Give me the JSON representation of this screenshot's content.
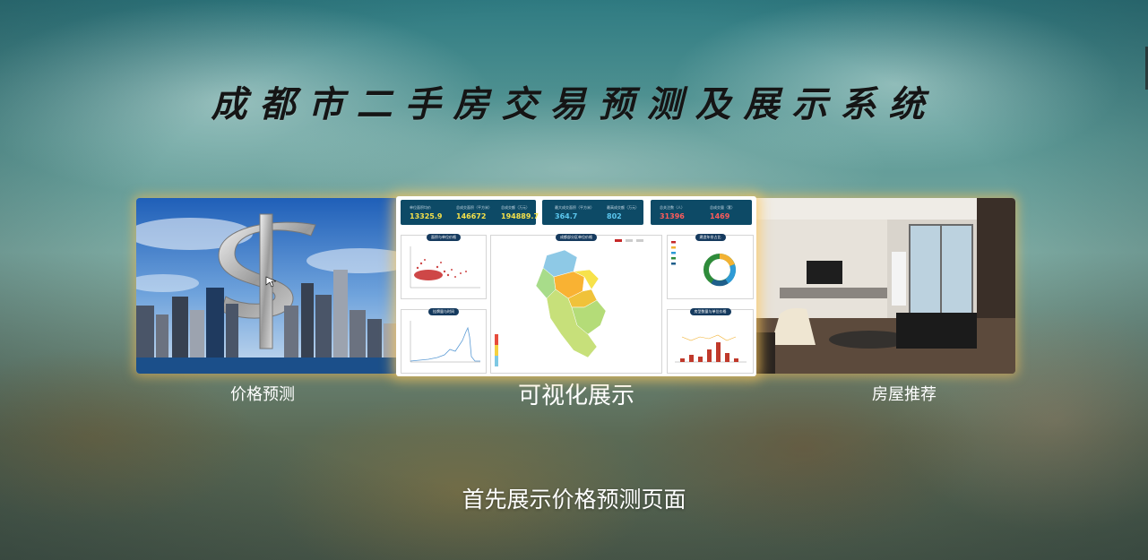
{
  "page": {
    "title": "成都市二手房交易预测及展示系统",
    "subtitle": "首先展示价格预测页面"
  },
  "carousel": {
    "slides": [
      {
        "label": "价格预测",
        "image": "city-dollar-sign-photo"
      },
      {
        "label": "可视化展示",
        "image": "dashboard-screenshot"
      },
      {
        "label": "房屋推荐",
        "image": "living-room-photo"
      }
    ]
  },
  "dashboard": {
    "stats": [
      {
        "label": "单位面积均价",
        "value": "13325.9",
        "color": "#f5e14a"
      },
      {
        "label": "总成交面积（平方米）",
        "value": "146672",
        "color": "#f5e14a"
      },
      {
        "label": "总成交额（万元）",
        "value": "194889.7",
        "color": "#f5e14a"
      },
      {
        "label": "最大成交面积（平方米）",
        "value": "364.7",
        "color": "#5cc8f0"
      },
      {
        "label": "最高成交额（万元）",
        "value": "802",
        "color": "#5cc8f0"
      },
      {
        "label": "总关注数（人）",
        "value": "31396",
        "color": "#ff5b5b"
      },
      {
        "label": "总成交量（套）",
        "value": "1469",
        "color": "#ff5b5b"
      }
    ],
    "panels": {
      "scatter": "面积与单位价格",
      "line": "挂牌量与时间",
      "map": "成都部分区单位价格",
      "donut": "建造年份占比",
      "bar": "房型数量与单位价格"
    }
  },
  "colors": {
    "glow": "#ffbe50",
    "navy": "#0d4a66",
    "scatter": "#c62828",
    "line": "#5b9bd5"
  }
}
